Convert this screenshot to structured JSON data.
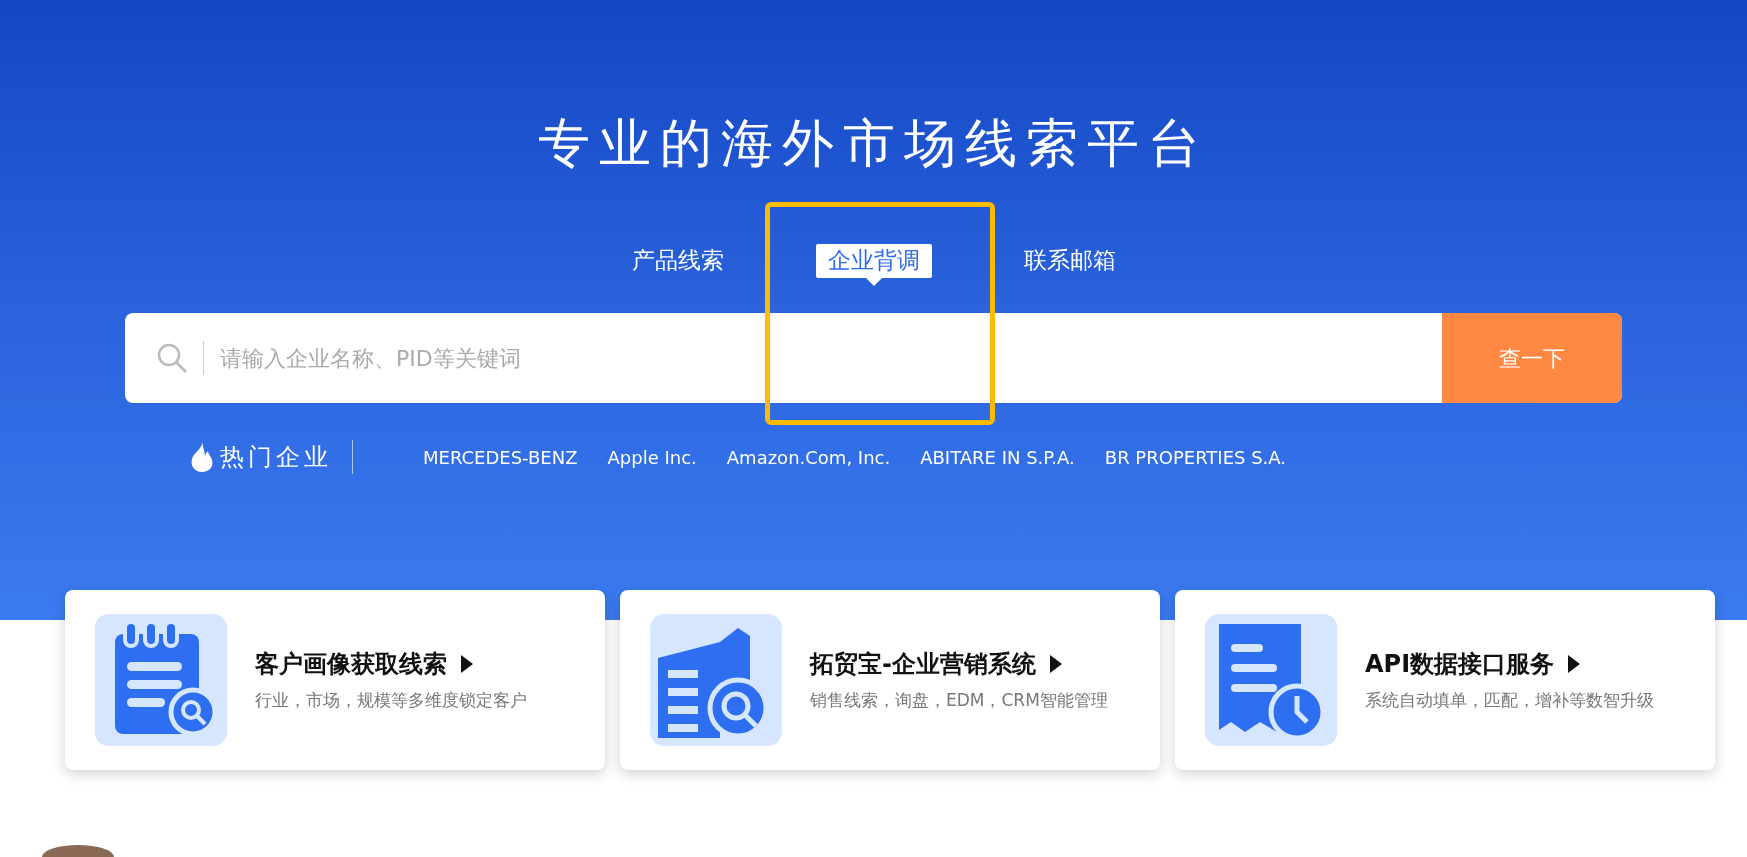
{
  "hero": {
    "title": "专业的海外市场线索平台"
  },
  "tabs": [
    {
      "label": "产品线索",
      "selected": false
    },
    {
      "label": "企业背调",
      "selected": true
    },
    {
      "label": "联系邮箱",
      "selected": false
    }
  ],
  "search": {
    "placeholder": "请输入企业名称、PID等关键词",
    "button": "查一下"
  },
  "hot": {
    "label": "热门企业",
    "companies": [
      "MERCEDES-BENZ",
      "Apple Inc.",
      "Amazon.Com, Inc.",
      "ABITARE IN S.P.A.",
      "BR PROPERTIES S.A."
    ]
  },
  "services": [
    {
      "kind": "notepad",
      "title": "客户画像获取线索",
      "description": "行业，市场，规模等多维度锁定客户"
    },
    {
      "kind": "building",
      "title": "拓贸宝-企业营销系统",
      "description": "销售线索，询盘，EDM，CRM智能管理"
    },
    {
      "kind": "document",
      "title": "API数据接口服务",
      "description": "系统自动填单，匹配，增补等数智升级"
    }
  ]
}
